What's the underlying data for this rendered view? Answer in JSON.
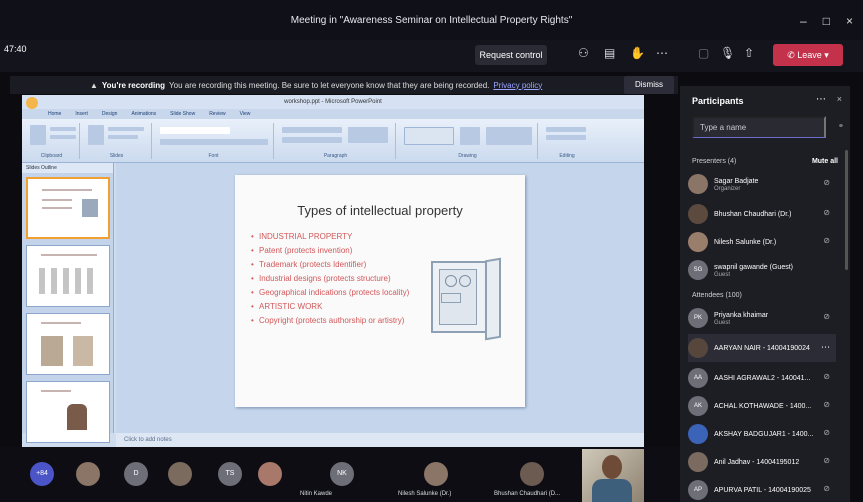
{
  "window": {
    "title": "Meeting in \"Awareness Seminar on Intellectual Property Rights\"",
    "elapsed": "47:40"
  },
  "toolbar": {
    "request_control": "Request control",
    "leave": "Leave"
  },
  "banner": {
    "strong": "You're recording",
    "text": "You are recording this meeting. Be sure to let everyone know that they are being recorded.",
    "link": "Privacy policy",
    "dismiss": "Dismiss"
  },
  "ppt": {
    "title": "workshop.ppt - Microsoft PowerPoint",
    "tabs": [
      "Home",
      "Insert",
      "Design",
      "Animations",
      "Slide Show",
      "Review",
      "View"
    ],
    "groups": [
      "Clipboard",
      "Slides",
      "Font",
      "Paragraph",
      "Drawing",
      "Editing"
    ],
    "slide_heading": "Types of intellectual property",
    "bullets": [
      "INDUSTRIAL PROPERTY",
      "Patent (protects invention)",
      "Trademark (protects Identifier)",
      "Industrial designs (protects structure)",
      "Geographical indications (protects locality)",
      "ARTISTIC WORK",
      "Copyright (protects authorship or artistry)"
    ],
    "notes": "Click to add notes",
    "thumb_tabs": "Slides   Outline"
  },
  "panel": {
    "title": "Participants",
    "search_placeholder": "Type a name",
    "presenters_label": "Presenters (4)",
    "mute_all": "Mute all",
    "attendees_label": "Attendees (100)",
    "presenters": [
      {
        "name": "Sagar Badjate",
        "role": "Organizer",
        "initials": ""
      },
      {
        "name": "Bhushan Chaudhari (Dr.)",
        "role": "",
        "initials": ""
      },
      {
        "name": "Nilesh Salunke (Dr.)",
        "role": "",
        "initials": ""
      },
      {
        "name": "swapnil gawande (Guest)",
        "role": "Guest",
        "initials": "SG"
      }
    ],
    "attendees": [
      {
        "name": "Priyanka khaimar",
        "role": "Guest",
        "initials": "PK"
      },
      {
        "name": "AARYAN NAIR - 14004190024",
        "role": "",
        "initials": ""
      },
      {
        "name": "AASHI AGRAWAL2 - 140041...",
        "role": "",
        "initials": "AA"
      },
      {
        "name": "ACHAL KOTHAWADE - 1400...",
        "role": "",
        "initials": "AK"
      },
      {
        "name": "AKSHAY BADGUJAR1 - 1400...",
        "role": "",
        "initials": ""
      },
      {
        "name": "Anil Jadhav - 14004195012",
        "role": "",
        "initials": ""
      },
      {
        "name": "APURVA PATIL - 14004190025",
        "role": "",
        "initials": "AP"
      }
    ]
  },
  "strip": {
    "tiles": [
      {
        "initials": "+84",
        "color": "#4b55c8"
      },
      {
        "initials": "",
        "color": "#8a7566"
      },
      {
        "initials": "D",
        "color": "#6e6e78"
      },
      {
        "initials": "",
        "color": "#7b6a5e"
      },
      {
        "initials": "TS",
        "color": "#6e6e78"
      },
      {
        "initials": "",
        "color": "#a8786a"
      },
      {
        "initials": "NK",
        "color": "#6e6e78"
      },
      {
        "initials": "",
        "color": "#8a7566"
      },
      {
        "initials": "",
        "color": "#6b5b50"
      }
    ],
    "labels": [
      "Nitin Kawde",
      "Nilesh Salunke (Dr.)",
      "Bhushan Chaudhari (D..."
    ]
  }
}
